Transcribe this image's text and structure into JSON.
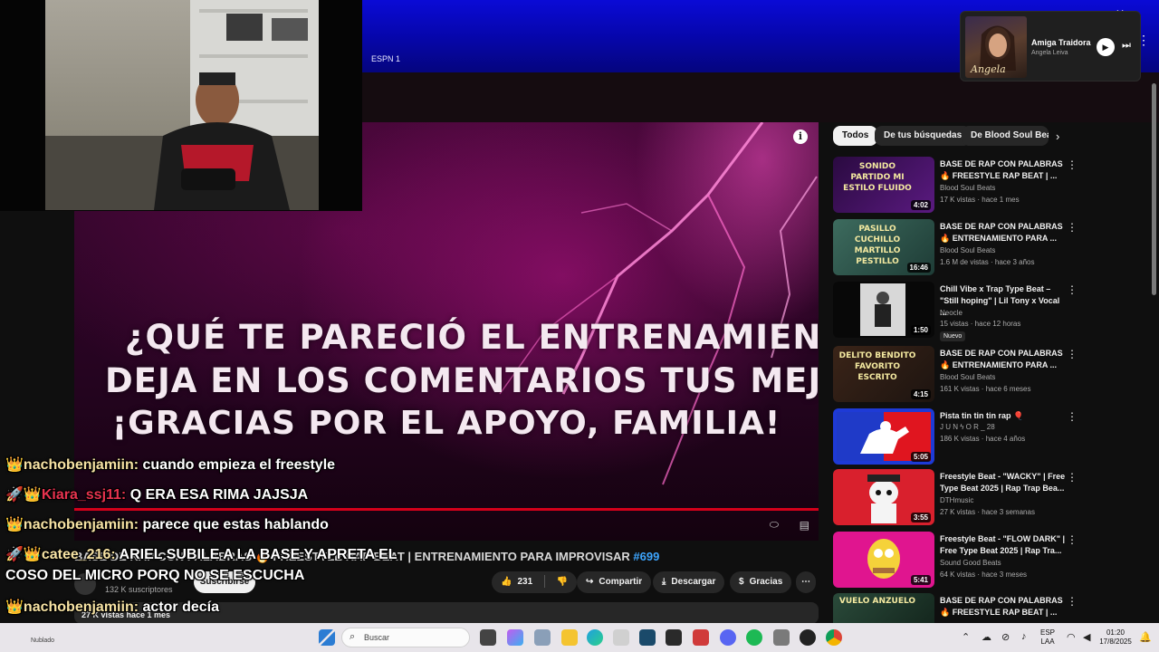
{
  "top_bar": {
    "bookmark": "ESPN 1"
  },
  "mini_player": {
    "song_title": "Amiga Traidora",
    "artist": "Angela Leiva",
    "art_caption": "Angela"
  },
  "video": {
    "overlay_lines": [
      "¿QUÉ TE PARECIÓ EL ENTRENAMIENTO?",
      "DEJA EN LOS COMENTARIOS TUS MEJORES F",
      "¡GRACIAS POR EL APOYO, FAMILIA!"
    ],
    "info_icon": "i"
  },
  "below_video": {
    "title_prefix": "BASE DE RAP CON PALABRAS 🔥 FREESTYLE RAP BEAT | ENTRENAMIENTO PARA IMPROVISAR ",
    "hashtag": "#699",
    "subscribers": "132 K suscriptores",
    "subscribe_label": "Suscribirse",
    "like_count": "231",
    "share_label": "Compartir",
    "download_label": "Descargar",
    "thanks_label": "Gracias",
    "views_line": "27 K vistas   hace 1 mes"
  },
  "chat": [
    {
      "badges": "👑",
      "user": "nachobenjamiin:",
      "user_color": "gold",
      "message": "cuando empieza el freestyle"
    },
    {
      "badges": "🚀👑",
      "user": "Kiara_ssj11:",
      "user_color": "red",
      "message": "Q ERA ESA RIMA JAJSJA"
    },
    {
      "badges": "👑",
      "user": "nachobenjamiin:",
      "user_color": "gold",
      "message": "parece que estas hablando"
    },
    {
      "badges": "🚀👑",
      "user": "catee_216:",
      "user_color": "gold",
      "message": "ARIEL SUBILE A LA BASE Y APRETA EL"
    },
    {
      "badges": "",
      "user": "",
      "user_color": "gold",
      "message": "COSO DEL MICRO PORQ NO SE ESCUCHA"
    },
    {
      "badges": "👑",
      "user": "nachobenjamiin:",
      "user_color": "gold",
      "message": "actor decía"
    },
    {
      "badges": "🚀👑",
      "user": "catee_216:",
      "user_color": "gold",
      "message": ":::"
    }
  ],
  "sidebar": {
    "chips": [
      "Todos",
      "De tus búsquedas",
      "De Blood Soul Beats"
    ],
    "items": [
      {
        "title": "BASE DE RAP CON PALABRAS 🔥 FREESTYLE RAP BEAT | ...",
        "channel": "Blood Soul Beats",
        "meta": "17 K vistas · hace 1 mes",
        "duration": "4:02",
        "thumb_text": "SONIDO PARTIDO MI ESTILO FLUIDO",
        "badge": ""
      },
      {
        "title": "BASE DE RAP CON PALABRAS 🔥 ENTRENAMIENTO PARA ...",
        "channel": "Blood Soul Beats",
        "meta": "1.6 M de vistas · hace 3 años",
        "duration": "16:46",
        "thumb_text": "PASILLO CUCHILLO MARTILLO PESTILLO",
        "badge": ""
      },
      {
        "title": "Chill Vibe x Trap Type Beat – \"Still hoping\" | Lil Tony x Vocal ...",
        "channel": "Neocle",
        "meta": "15 vistas · hace 12 horas",
        "duration": "1:50",
        "thumb_text": "",
        "badge": "Nuevo"
      },
      {
        "title": "BASE DE RAP CON PALABRAS 🔥 ENTRENAMIENTO PARA ...",
        "channel": "Blood Soul Beats",
        "meta": "161 K vistas · hace 6 meses",
        "duration": "4:15",
        "thumb_text": "DELITO BENDITO FAVORITO ESCRITO",
        "badge": ""
      },
      {
        "title": "Pista tin tin tin rap 🎈",
        "channel": "J U N ϟ O R _ 28",
        "meta": "186 K vistas · hace 4 años",
        "duration": "5:05",
        "thumb_text": "",
        "badge": ""
      },
      {
        "title": "Freestyle Beat - \"WACKY\" | Free Type Beat 2025 | Rap Trap Bea...",
        "channel": "DTHmusic",
        "meta": "27 K vistas · hace 3 semanas",
        "duration": "3:55",
        "thumb_text": "",
        "badge": ""
      },
      {
        "title": "Freestyle Beat - \"FLOW DARK\" | Free Type Beat 2025 | Rap Tra...",
        "channel": "Sound Good Beats",
        "meta": "64 K vistas · hace 3 meses",
        "duration": "5:41",
        "thumb_text": "",
        "badge": ""
      },
      {
        "title": "BASE DE RAP CON PALABRAS 🔥 FREESTYLE RAP BEAT | ...",
        "channel": "Blood Soul Beats",
        "meta": "",
        "duration": "",
        "thumb_text": "VUELO ANZUELO",
        "badge": ""
      }
    ]
  },
  "taskbar": {
    "left_text": "Nublado",
    "search_placeholder": "Buscar",
    "lang_top": "ESP",
    "lang_bottom": "LAA",
    "time": "01:20",
    "date": "17/8/2025"
  }
}
